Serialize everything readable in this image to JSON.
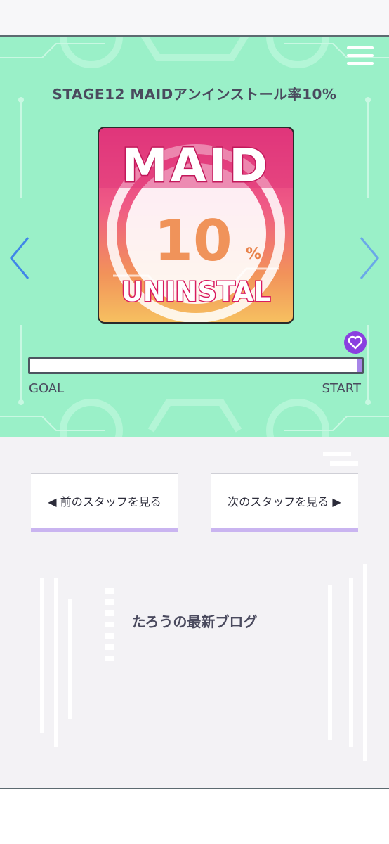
{
  "stage": {
    "title": "STAGE12 MAIDアンインストール率10%",
    "logo": {
      "line1": "MAID",
      "percent_value": "10",
      "percent_sign": "%",
      "line3": "UNINSTAL"
    },
    "progress": {
      "percent": 1.5,
      "goal_label": "GOAL",
      "start_label": "START"
    }
  },
  "nav": {
    "prev_label": "◀ 前のスタッフを見る",
    "next_label": "次のスタッフを見る ▶"
  },
  "blog": {
    "heading": "たろうの最新ブログ"
  },
  "colors": {
    "panel_bg": "#9af0c8",
    "accent_purple": "#a785e8",
    "arrow_blue": "#3f86e8",
    "lower_bg": "#f3f2f5"
  },
  "icons": {
    "menu": "hamburger-icon",
    "left": "chevron-left-icon",
    "right": "chevron-right-icon",
    "marker": "heart-icon"
  }
}
